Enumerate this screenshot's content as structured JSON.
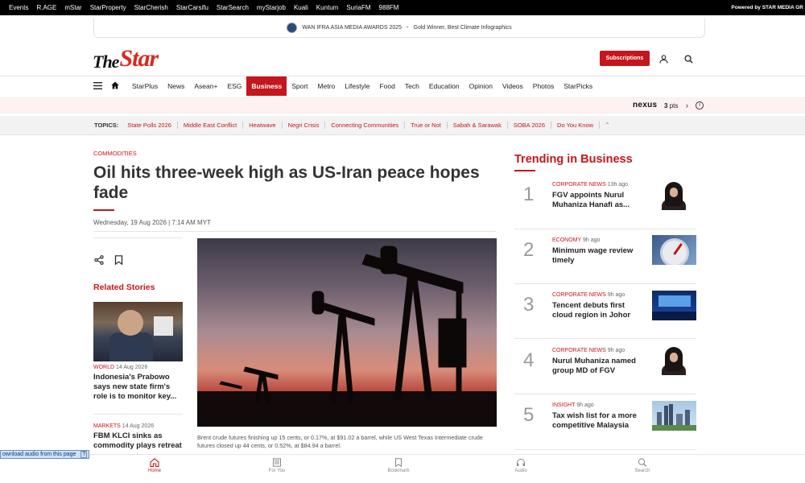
{
  "topbar": {
    "links": [
      "Events",
      "R.AGE",
      "mStar",
      "StarProperty",
      "StarCherish",
      "StarCarsifu",
      "StarSearch",
      "myStarjob",
      "Kuali",
      "Kuntum",
      "SuriaFM",
      "988FM"
    ],
    "powered": "Powered by STAR MEDIA GR"
  },
  "award": {
    "title": "WAN IFRA ASIA MEDIA AWARDS 2025",
    "subtitle": "Gold Winner, Best Climate Infographics"
  },
  "logo": {
    "the": "The",
    "star": "Star"
  },
  "header": {
    "subscribe_label": "Subscriptions",
    "user_icon": "user-icon",
    "search_icon": "search-icon"
  },
  "nav": {
    "items": [
      "StarPlus",
      "News",
      "Asean+",
      "ESG",
      "Business",
      "Sport",
      "Metro",
      "Lifestyle",
      "Food",
      "Tech",
      "Education",
      "Opinion",
      "Videos",
      "Photos",
      "StarPicks"
    ],
    "active": "Business"
  },
  "nexus": {
    "brand": "nexus",
    "points": "3",
    "unit": "pts"
  },
  "topics": {
    "label": "TOPICS:",
    "items": [
      "State Polls 2026",
      "Middle East Conflict",
      "Heatwave",
      "Negri Crisis",
      "Connecting Communities",
      "True or Not",
      "Sabah & Sarawak",
      "SOBA 2026",
      "Do You Know"
    ]
  },
  "article": {
    "kicker": "COMMODITIES",
    "headline": "Oil hits three-week high as US-Iran peace hopes fade",
    "date": "Wednesday, 19 Aug 2026 | 7:14 AM MYT",
    "caption": "Brent crude futures finishing up 15 cents, or 0.17%, at $91.02 a barrel, while US West Texas Intermediate crude futures closed up 44 cents, or 0.52%, at $84.94 a barrel."
  },
  "related": {
    "title": "Related Stories",
    "items": [
      {
        "category": "WORLD",
        "date": "14 Aug 2026",
        "title": "Indonesia's Prabowo says new state firm's role is to monitor key..."
      },
      {
        "category": "MARKETS",
        "date": "14 Aug 2026",
        "title": "FBM KLCI sinks as commodity plays retreat"
      }
    ]
  },
  "trending": {
    "title": "Trending in Business",
    "items": [
      {
        "num": "1",
        "category": "CORPORATE NEWS",
        "time": "13h ago",
        "title": "FGV appoints Nurul Muhaniza Hanafi as..."
      },
      {
        "num": "2",
        "category": "ECONOMY",
        "time": "9h ago",
        "title": "Minimum wage review timely"
      },
      {
        "num": "3",
        "category": "CORPORATE NEWS",
        "time": "9h ago",
        "title": "Tencent debuts first cloud region in Johor"
      },
      {
        "num": "4",
        "category": "CORPORATE NEWS",
        "time": "9h ago",
        "title": "Nurul Muhaniza named group MD of FGV"
      },
      {
        "num": "5",
        "category": "INSIGHT",
        "time": "9h ago",
        "title": "Tax wish list for a more competitive Malaysia"
      }
    ]
  },
  "bottom_nav": {
    "items": [
      {
        "label": "Home",
        "icon": "home-icon"
      },
      {
        "label": "For You",
        "icon": "newspaper-icon"
      },
      {
        "label": "Bookmark",
        "icon": "bookmark-icon"
      },
      {
        "label": "Audio",
        "icon": "headphones-icon"
      },
      {
        "label": "Search",
        "icon": "search-icon"
      }
    ],
    "active": "Home"
  },
  "audio_widget": {
    "label": "ownload audio from this page",
    "controls": "?"
  },
  "colors": {
    "accent": "#c4161c",
    "topbar": "#000000"
  }
}
